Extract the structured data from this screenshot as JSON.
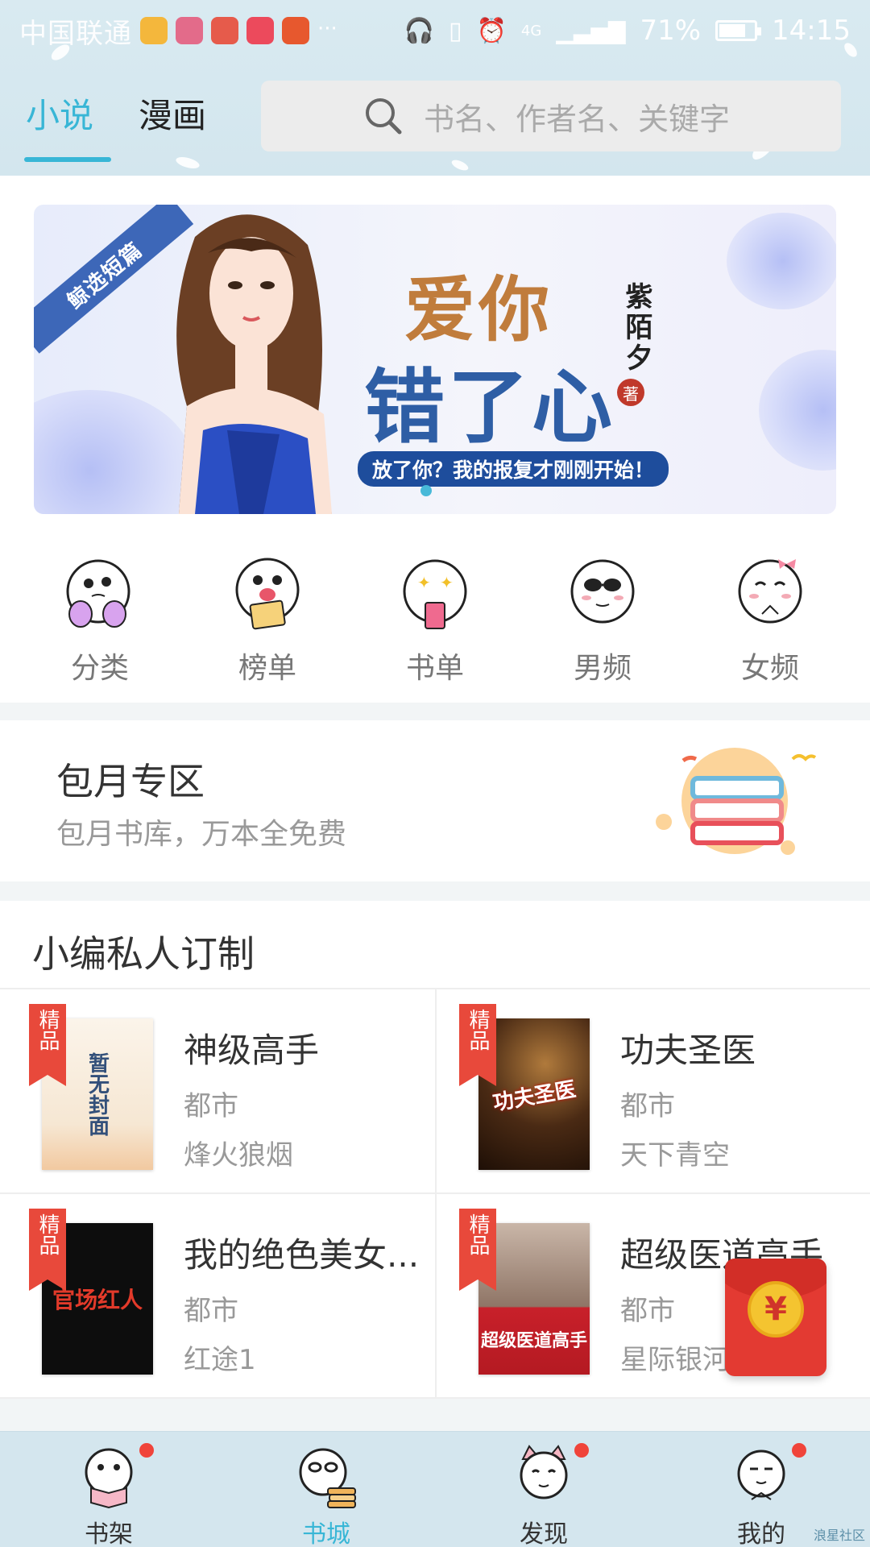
{
  "status_bar": {
    "carrier": "中国联通",
    "time": "14:15",
    "battery": "71%",
    "network": "4G"
  },
  "tabs": [
    {
      "label": "小说",
      "active": true
    },
    {
      "label": "漫画",
      "active": false
    }
  ],
  "search": {
    "placeholder": "书名、作者名、关键字"
  },
  "banner": {
    "ribbon": "鲸选短篇",
    "title_line1": "爱你",
    "title_line2": "错了心",
    "author": "紫陌夕",
    "seal": "著",
    "slogan": "放了你？我的报复才刚刚开始！"
  },
  "quick_nav": [
    {
      "label": "分类",
      "icon": "category-face-icon"
    },
    {
      "label": "榜单",
      "icon": "ranking-face-icon"
    },
    {
      "label": "书单",
      "icon": "booklist-face-icon"
    },
    {
      "label": "男频",
      "icon": "male-channel-face-icon"
    },
    {
      "label": "女频",
      "icon": "female-channel-face-icon"
    }
  ],
  "monthly": {
    "title": "包月专区",
    "subtitle": "包月书库，万本全免费"
  },
  "custom": {
    "title": "小编私人订制",
    "badge": "精品",
    "books": [
      {
        "name": "神级高手",
        "genre": "都市",
        "author": "烽火狼烟",
        "cover_text": "暂无封面"
      },
      {
        "name": "功夫圣医",
        "genre": "都市",
        "author": "天下青空",
        "cover_text": "功夫圣医"
      },
      {
        "name": "我的绝色美女...",
        "genre": "都市",
        "author": "红途1",
        "cover_text": "官场红人"
      },
      {
        "name": "超级医道高手",
        "genre": "都市",
        "author": "星际银河",
        "cover_text": "超级医道高手"
      }
    ]
  },
  "redpacket": {
    "symbol": "¥"
  },
  "bottom_nav": [
    {
      "label": "书架",
      "active": false,
      "dot": true
    },
    {
      "label": "书城",
      "active": true,
      "dot": false
    },
    {
      "label": "发现",
      "active": false,
      "dot": true
    },
    {
      "label": "我的",
      "active": false,
      "dot": true
    }
  ],
  "watermark": "浪星社区",
  "colors": {
    "accent": "#38b6d6",
    "badge": "#e8493b",
    "top_bg": "#d9eaf1"
  }
}
